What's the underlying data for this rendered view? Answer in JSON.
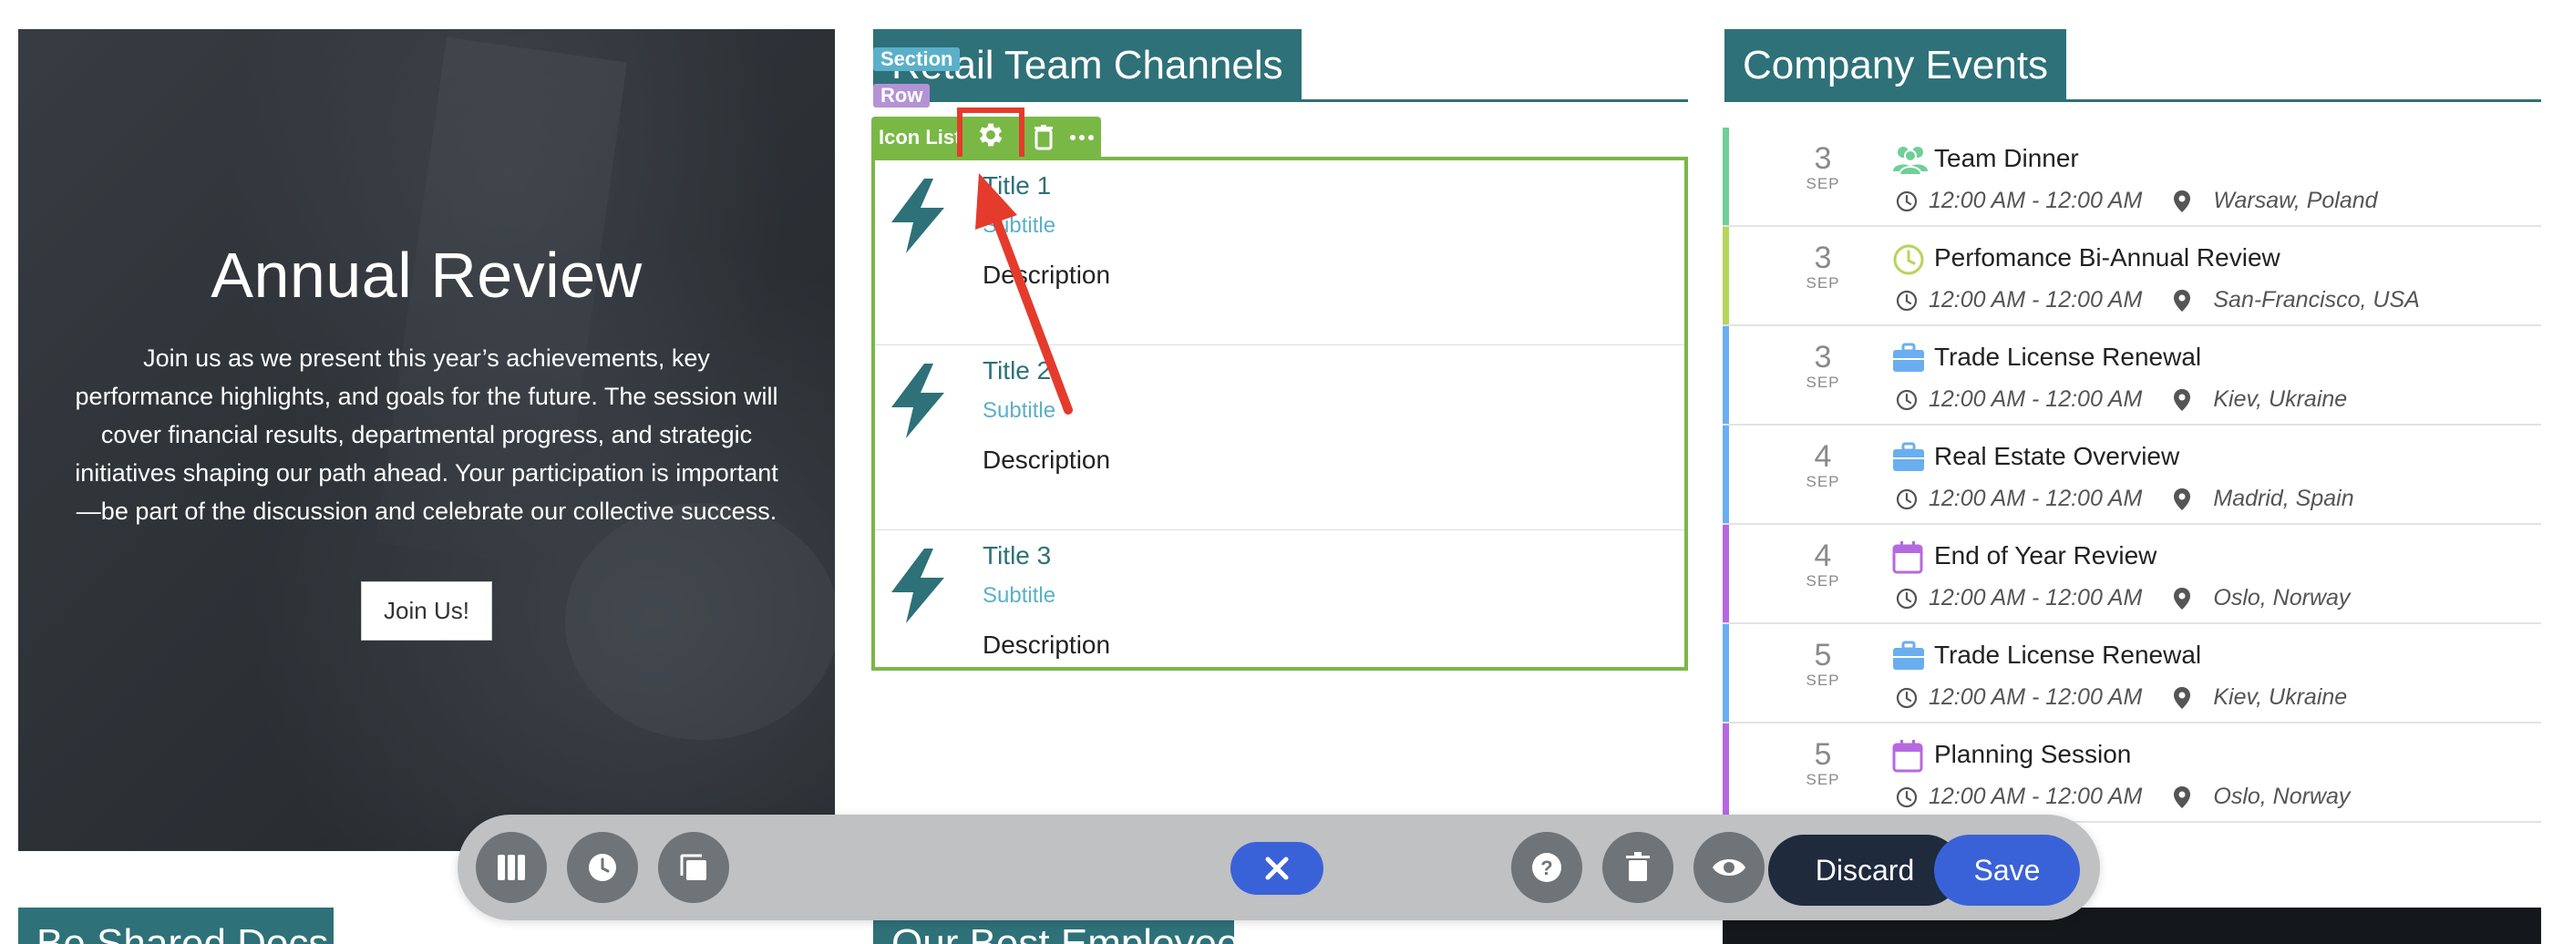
{
  "hero": {
    "title": "Annual Review",
    "text": "Join us as we present this year’s achievements, key performance highlights, and goals for the future. The session will cover financial results, departmental progress, and strategic initiatives shaping our path ahead. Your participation is important—be part of the discussion and celebrate our collective success.",
    "button": "Join Us!"
  },
  "channels": {
    "title": "Retail Team Channels",
    "badges": {
      "section": "Section",
      "row": "Row",
      "module": "Icon List"
    },
    "items": [
      {
        "title": "Title 1",
        "subtitle": "Subtitle",
        "description": "Description"
      },
      {
        "title": "Title 2",
        "subtitle": "Subtitle",
        "description": "Description"
      },
      {
        "title": "Title 3",
        "subtitle": "Subtitle",
        "description": "Description"
      }
    ]
  },
  "events": {
    "title": "Company Events",
    "items": [
      {
        "day": "3",
        "month": "SEP",
        "title": "Team Dinner",
        "time": "12:00 AM - 12:00 AM",
        "location": "Warsaw, Poland",
        "icon": "people-icon",
        "color": "#6fcf97"
      },
      {
        "day": "3",
        "month": "SEP",
        "title": "Perfomance Bi-Annual Review",
        "time": "12:00 AM - 12:00 AM",
        "location": "San-Francisco, USA",
        "icon": "clock-icon",
        "color": "#b6d55a"
      },
      {
        "day": "3",
        "month": "SEP",
        "title": "Trade License Renewal",
        "time": "12:00 AM - 12:00 AM",
        "location": "Kiev, Ukraine",
        "icon": "briefcase-icon",
        "color": "#6aaef0"
      },
      {
        "day": "4",
        "month": "SEP",
        "title": "Real Estate Overview",
        "time": "12:00 AM - 12:00 AM",
        "location": "Madrid, Spain",
        "icon": "briefcase-icon",
        "color": "#6aaef0"
      },
      {
        "day": "4",
        "month": "SEP",
        "title": "End of Year Review",
        "time": "12:00 AM - 12:00 AM",
        "location": "Oslo, Norway",
        "icon": "calendar-icon",
        "color": "#b569e0"
      },
      {
        "day": "5",
        "month": "SEP",
        "title": "Trade License Renewal",
        "time": "12:00 AM - 12:00 AM",
        "location": "Kiev, Ukraine",
        "icon": "briefcase-icon",
        "color": "#6aaef0"
      },
      {
        "day": "5",
        "month": "SEP",
        "title": "Planning Session",
        "time": "12:00 AM - 12:00 AM",
        "location": "Oslo, Norway",
        "icon": "calendar-icon",
        "color": "#b569e0"
      }
    ]
  },
  "bottom": {
    "left_title": "Be Shared Docs",
    "mid_title": "Our Best Employees"
  },
  "toolbar": {
    "discard_label": "Discard",
    "save_label": "Save"
  },
  "colors": {
    "teal": "#2e7178",
    "green": "#7ab846",
    "blue": "#3a62d8",
    "highlight": "#e53b2c"
  }
}
